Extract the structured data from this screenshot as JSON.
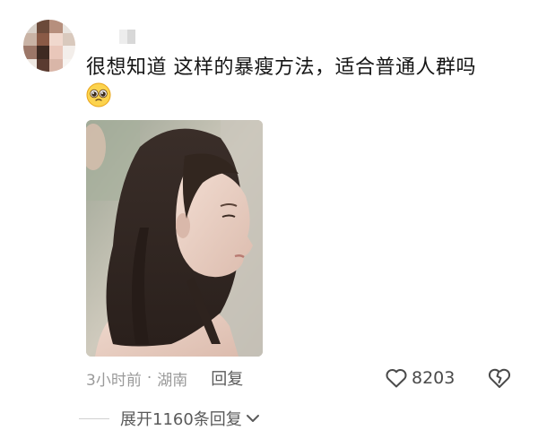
{
  "comment": {
    "text": "很想知道  这样的暴瘦方法，适合普通人群吗",
    "emoji": "pleading-face",
    "time": "3小时前",
    "location": "湖南",
    "separator": "·",
    "reply_label": "回复",
    "likes": "8203"
  },
  "replies": {
    "expand_label": "展开1160条回复"
  },
  "colors": {
    "text": "#151515",
    "meta": "#9a9a9a",
    "reply": "#5b5b5b"
  }
}
